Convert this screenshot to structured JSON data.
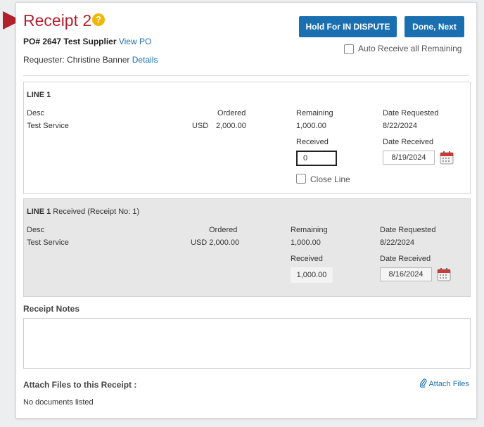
{
  "header": {
    "title": "Receipt 2",
    "help_icon": "question-icon",
    "help_glyph": "?",
    "po_label": "PO# 2647 Test Supplier",
    "view_po": "View PO",
    "requester_label": "Requester: Christine Banner",
    "details": "Details"
  },
  "actions": {
    "hold_label": "Hold For IN DISPUTE",
    "done_label": "Done, Next",
    "auto_receive_label": "Auto Receive all Remaining",
    "auto_receive_checked": false
  },
  "line1": {
    "header": "LINE 1",
    "desc_label": "Desc",
    "desc": "Test Service",
    "ordered_label": "Ordered",
    "currency": "USD",
    "ordered": "2,000.00",
    "remaining_label": "Remaining",
    "remaining": "1,000.00",
    "date_requested_label": "Date Requested",
    "date_requested": "8/22/2024",
    "received_label": "Received",
    "received_value": "0",
    "date_received_label": "Date Received",
    "date_received": "8/19/2024",
    "close_line_label": "Close Line",
    "close_line_checked": false
  },
  "line2": {
    "header": "LINE 1",
    "header_suffix": "Received (Receipt No: 1)",
    "desc_label": "Desc",
    "desc": "Test Service",
    "ordered_label": "Ordered",
    "ordered": "USD 2,000.00",
    "remaining_label": "Remaining",
    "remaining": "1,000.00",
    "date_requested_label": "Date Requested",
    "date_requested": "8/22/2024",
    "received_label": "Received",
    "received_value": "1,000.00",
    "date_received_label": "Date Received",
    "date_received": "8/16/2024"
  },
  "notes": {
    "label": "Receipt Notes",
    "value": ""
  },
  "attachments": {
    "label": "Attach Files to this Receipt :",
    "attach_link": "Attach Files",
    "empty_text": "No documents listed"
  },
  "colors": {
    "accent": "#b21f2d",
    "button": "#1a6fb0",
    "help": "#f2b705"
  }
}
